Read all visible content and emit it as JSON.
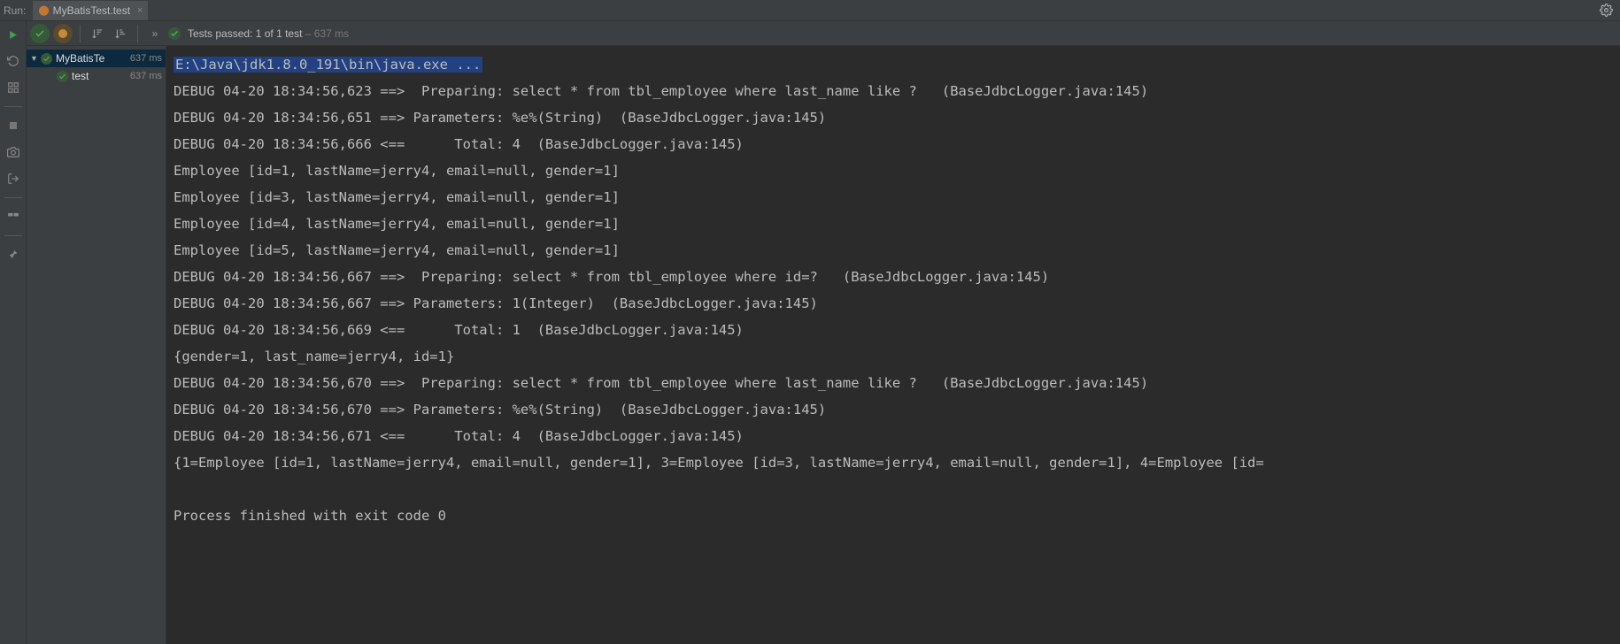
{
  "topbar": {
    "run_label": "Run:",
    "tab_label": "MyBatisTest.test"
  },
  "status": {
    "prefix": "Tests passed:",
    "count": "1",
    "of": "of 1 test",
    "time": "– 637 ms"
  },
  "tree": {
    "root_label": "MyBatisTe",
    "root_time": "637 ms",
    "child_label": "test",
    "child_time": "637 ms"
  },
  "console": {
    "lines": [
      {
        "head": true,
        "text": "E:\\Java\\jdk1.8.0_191\\bin\\java.exe ..."
      },
      {
        "text": "DEBUG 04-20 18:34:56,623 ==>  Preparing: select * from tbl_employee where last_name like ?   (BaseJdbcLogger.java:145)"
      },
      {
        "text": "DEBUG 04-20 18:34:56,651 ==> Parameters: %e%(String)  (BaseJdbcLogger.java:145)"
      },
      {
        "text": "DEBUG 04-20 18:34:56,666 <==      Total: 4  (BaseJdbcLogger.java:145)"
      },
      {
        "text": "Employee [id=1, lastName=jerry4, email=null, gender=1]"
      },
      {
        "text": "Employee [id=3, lastName=jerry4, email=null, gender=1]"
      },
      {
        "text": "Employee [id=4, lastName=jerry4, email=null, gender=1]"
      },
      {
        "text": "Employee [id=5, lastName=jerry4, email=null, gender=1]"
      },
      {
        "text": "DEBUG 04-20 18:34:56,667 ==>  Preparing: select * from tbl_employee where id=?   (BaseJdbcLogger.java:145)"
      },
      {
        "text": "DEBUG 04-20 18:34:56,667 ==> Parameters: 1(Integer)  (BaseJdbcLogger.java:145)"
      },
      {
        "text": "DEBUG 04-20 18:34:56,669 <==      Total: 1  (BaseJdbcLogger.java:145)"
      },
      {
        "text": "{gender=1, last_name=jerry4, id=1}"
      },
      {
        "text": "DEBUG 04-20 18:34:56,670 ==>  Preparing: select * from tbl_employee where last_name like ?   (BaseJdbcLogger.java:145)"
      },
      {
        "text": "DEBUG 04-20 18:34:56,670 ==> Parameters: %e%(String)  (BaseJdbcLogger.java:145)"
      },
      {
        "text": "DEBUG 04-20 18:34:56,671 <==      Total: 4  (BaseJdbcLogger.java:145)"
      },
      {
        "text": "{1=Employee [id=1, lastName=jerry4, email=null, gender=1], 3=Employee [id=3, lastName=jerry4, email=null, gender=1], 4=Employee [id="
      },
      {
        "text": ""
      },
      {
        "text": "Process finished with exit code 0"
      }
    ]
  }
}
